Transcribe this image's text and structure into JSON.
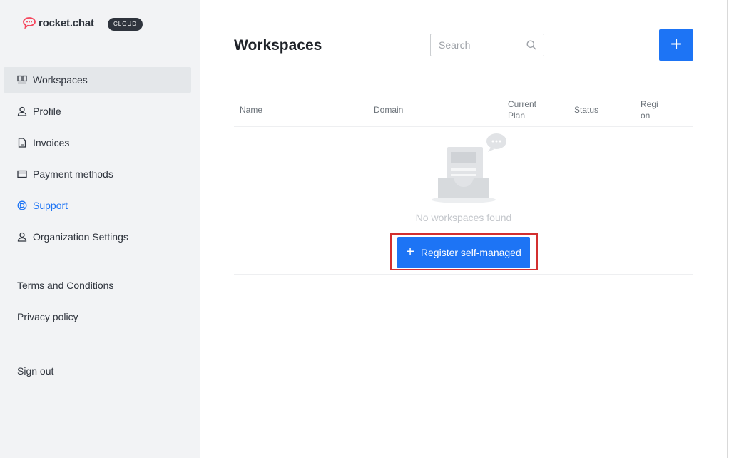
{
  "brand": {
    "name": "rocket.chat",
    "badge": "CLOUD",
    "color": "#f5455c"
  },
  "sidebar": {
    "items": [
      {
        "label": "Workspaces",
        "icon": "workspaces-icon",
        "active": true
      },
      {
        "label": "Profile",
        "icon": "user-icon"
      },
      {
        "label": "Invoices",
        "icon": "document-icon"
      },
      {
        "label": "Payment methods",
        "icon": "credit-card-icon"
      },
      {
        "label": "Support",
        "icon": "lifebuoy-icon",
        "highlighted": true
      },
      {
        "label": "Organization Settings",
        "icon": "user-icon"
      }
    ],
    "links": {
      "terms": "Terms and Conditions",
      "privacy": "Privacy policy",
      "signout": "Sign out"
    }
  },
  "main": {
    "title": "Workspaces",
    "search": {
      "placeholder": "Search",
      "value": ""
    },
    "add_button": "+",
    "table": {
      "columns": [
        "Name",
        "Domain",
        "Current Plan",
        "Status",
        "Region"
      ],
      "empty_text": "No workspaces found"
    },
    "register_button": "Register self-managed"
  },
  "colors": {
    "accent": "#1d74f5",
    "sidebar_bg": "#f2f3f5",
    "highlight_border": "#d32f2f"
  }
}
